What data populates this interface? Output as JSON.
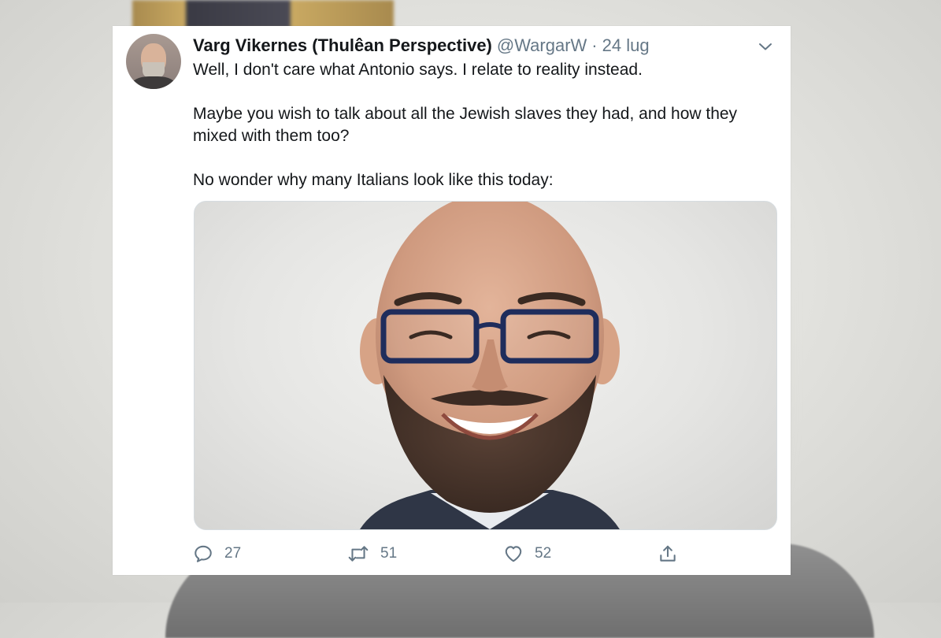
{
  "tweet": {
    "author": {
      "display_name": "Varg Vikernes (Thulêan Perspective)",
      "handle": "@WargarW",
      "avatar_icon": "user-avatar"
    },
    "separator": "·",
    "timestamp": "24 lug",
    "menu_icon": "chevron-down-icon",
    "text_paragraphs": [
      "Well, I don't care what Antonio says. I relate to reality instead.",
      "Maybe you wish to talk about all the Jewish slaves they had, and how they mixed with them too?",
      "No wonder why many Italians look like this today:"
    ],
    "media": {
      "type": "photo",
      "icon": "photo-of-smiling-bald-man-with-glasses"
    },
    "actions": {
      "reply": {
        "icon": "reply-icon",
        "count": "27"
      },
      "retweet": {
        "icon": "retweet-icon",
        "count": "51"
      },
      "like": {
        "icon": "heart-icon",
        "count": "52"
      },
      "share": {
        "icon": "share-icon"
      }
    }
  },
  "colors": {
    "text_primary": "#14171a",
    "text_secondary": "#657786",
    "card_background": "#ffffff"
  }
}
